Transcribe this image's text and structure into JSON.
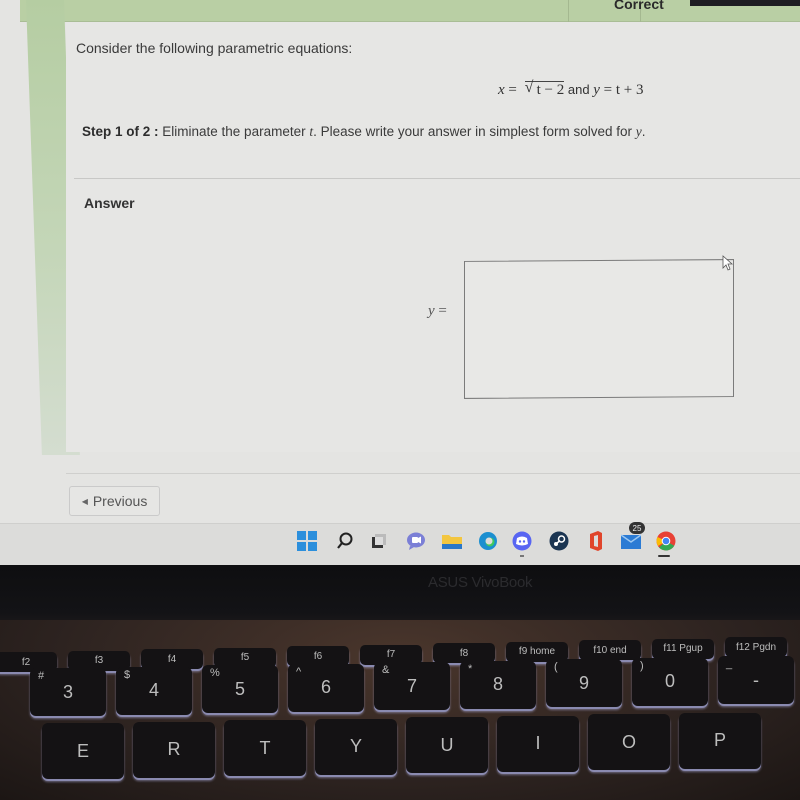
{
  "header": {
    "status_label": "Correct"
  },
  "question": {
    "intro": "Consider the following parametric equations:",
    "equation": {
      "x_lhs": "x",
      "eq1": " = ",
      "radicand": "t − 2",
      "and": " and ",
      "y_lhs": "y",
      "eq2": " = ",
      "y_rhs": "t + 3"
    },
    "step_label": "Step 1 of 2 :",
    "step_text_1": " Eliminate the parameter ",
    "step_param": "t",
    "step_text_2": ". Please write your answer in simplest form solved for ",
    "step_var": "y",
    "step_text_3": "."
  },
  "answer": {
    "label": "Answer",
    "var": "y",
    "equals": " =",
    "value": ""
  },
  "nav": {
    "previous_label": "Previous"
  },
  "taskbar": {
    "icons": [
      {
        "name": "windows-start",
        "color": "#1f8ad8"
      },
      {
        "name": "search",
        "color": "#222222"
      },
      {
        "name": "task-view",
        "color": "#333333"
      },
      {
        "name": "teams-chat",
        "color": "#6264a7"
      },
      {
        "name": "file-explorer",
        "color": "#f2c33c"
      },
      {
        "name": "edge",
        "color": "#1a8fd0"
      },
      {
        "name": "discord",
        "color": "#5865f2"
      },
      {
        "name": "steam",
        "color": "#1b3552"
      },
      {
        "name": "office",
        "color": "#e0452b"
      },
      {
        "name": "mail",
        "color": "#2b7bd4"
      },
      {
        "name": "chrome",
        "color": "#4285f4"
      }
    ],
    "mail_badge": "25"
  },
  "laptop": {
    "brand": "ASUS VivoBook"
  },
  "keyboard": {
    "fn_keys": [
      "f2",
      "f3",
      "f4",
      "f5",
      "f6",
      "f7",
      "f8",
      "f9 home",
      "f10 end",
      "f11 Pgup",
      "f12 Pgdn"
    ],
    "number_row": [
      {
        "main": "3",
        "shift": "#"
      },
      {
        "main": "4",
        "shift": "$"
      },
      {
        "main": "5",
        "shift": "%"
      },
      {
        "main": "6",
        "shift": "^"
      },
      {
        "main": "7",
        "shift": "&"
      },
      {
        "main": "8",
        "shift": "*"
      },
      {
        "main": "9",
        "shift": "("
      },
      {
        "main": "0",
        "shift": ")"
      },
      {
        "main": "-",
        "shift": "_"
      }
    ],
    "letter_row": [
      "E",
      "R",
      "T",
      "Y",
      "U",
      "I",
      "O",
      "P"
    ]
  }
}
